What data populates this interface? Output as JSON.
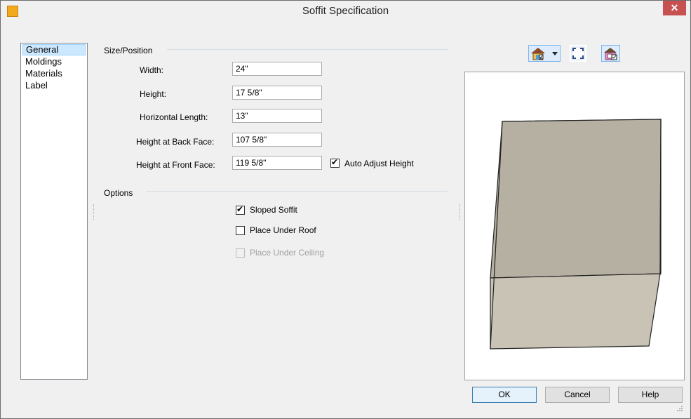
{
  "window": {
    "title": "Soffit Specification",
    "close_glyph": "✕",
    "accent_close": "#c75050"
  },
  "nav": {
    "items": [
      {
        "label": "General",
        "selected": true
      },
      {
        "label": "Moldings",
        "selected": false
      },
      {
        "label": "Materials",
        "selected": false
      },
      {
        "label": "Label",
        "selected": false
      }
    ]
  },
  "size_position": {
    "group_label": "Size/Position",
    "width": {
      "label": "Width:",
      "value": "24\""
    },
    "height": {
      "label": "Height:",
      "value": "17 5/8\""
    },
    "horizontal_length": {
      "label": "Horizontal Length:",
      "value": "13\""
    },
    "height_back_face": {
      "label": "Height at Back Face:",
      "value": "107 5/8\""
    },
    "height_front_face": {
      "label": "Height at Front Face:",
      "value": "119 5/8\""
    },
    "auto_adjust_height": {
      "label": "Auto Adjust Height",
      "checked": true
    }
  },
  "options": {
    "group_label": "Options",
    "sloped_soffit": {
      "label": "Sloped Soffit",
      "checked": true,
      "enabled": true
    },
    "place_under_roof": {
      "label": "Place Under Roof",
      "checked": false,
      "enabled": true
    },
    "place_under_ceiling": {
      "label": "Place Under Ceiling",
      "checked": false,
      "enabled": false
    }
  },
  "preview_toolbar": {
    "icons": [
      "house-view-icon",
      "dropdown-arrow-icon",
      "fit-to-window-icon",
      "house-options-icon"
    ]
  },
  "footer": {
    "ok_label": "OK",
    "cancel_label": "Cancel",
    "help_label": "Help"
  }
}
